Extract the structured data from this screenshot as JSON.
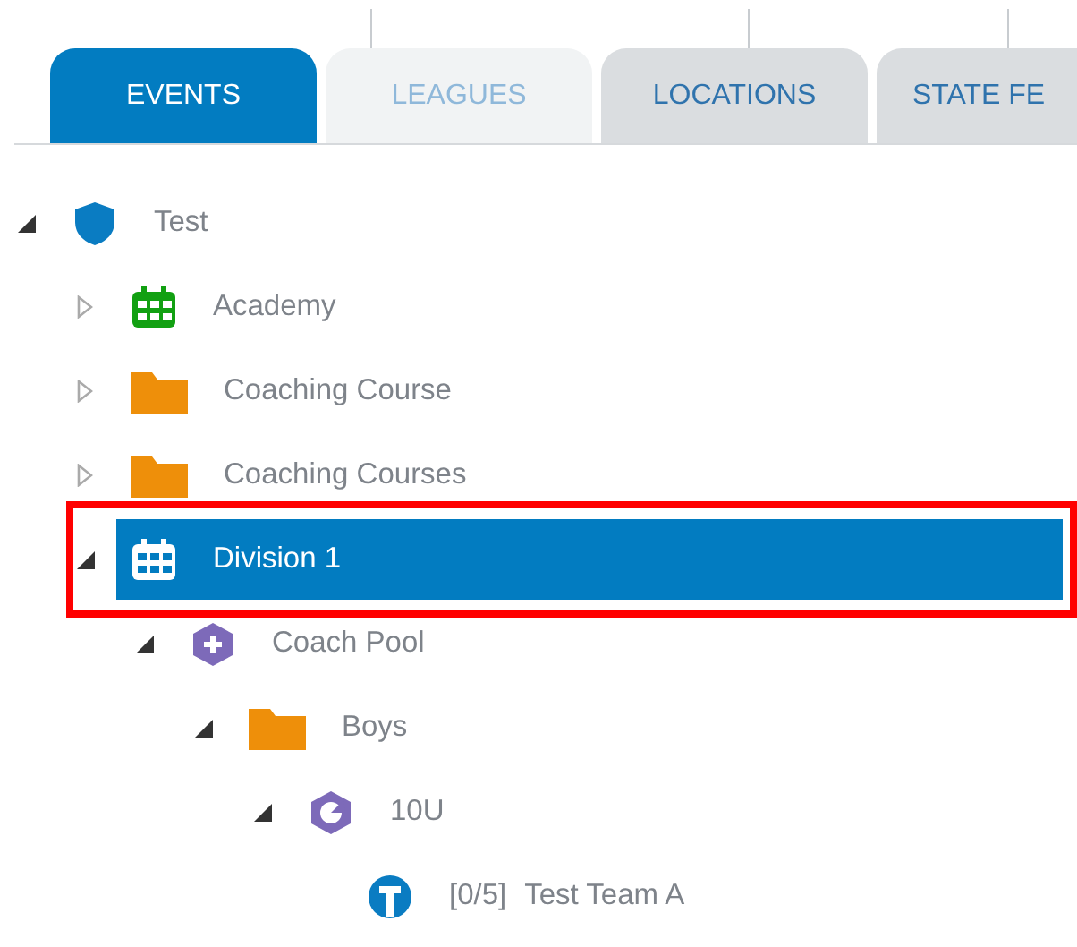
{
  "tabs": [
    {
      "label": "EVENTS",
      "selected": true,
      "disabled": false
    },
    {
      "label": "LEAGUES",
      "selected": false,
      "disabled": true
    },
    {
      "label": "LOCATIONS",
      "selected": false,
      "disabled": false
    },
    {
      "label": "STATE FE",
      "selected": false,
      "disabled": false
    }
  ],
  "tree": [
    {
      "label": "Test",
      "kind": "shield",
      "expanded": true,
      "selected": false,
      "children": [
        {
          "label": "Academy",
          "kind": "calendar",
          "expanded": false,
          "selected": false
        },
        {
          "label": "Coaching Course",
          "kind": "folder",
          "expanded": false,
          "selected": false
        },
        {
          "label": "Coaching Courses",
          "kind": "folder",
          "expanded": false,
          "selected": false
        },
        {
          "label": "Division 1",
          "kind": "calendar",
          "expanded": true,
          "selected": true,
          "highlighted": true,
          "children": [
            {
              "label": "Coach Pool",
              "kind": "hex-plus",
              "expanded": true,
              "selected": false,
              "children": [
                {
                  "label": "Boys",
                  "kind": "folder",
                  "expanded": true,
                  "selected": false,
                  "children": [
                    {
                      "label": "10U",
                      "kind": "hex-ring",
                      "expanded": true,
                      "selected": false,
                      "children": [
                        {
                          "label": "Test Team A",
                          "count": "[0/5]",
                          "kind": "team",
                          "selected": false
                        }
                      ]
                    }
                  ]
                }
              ]
            }
          ]
        }
      ]
    }
  ]
}
